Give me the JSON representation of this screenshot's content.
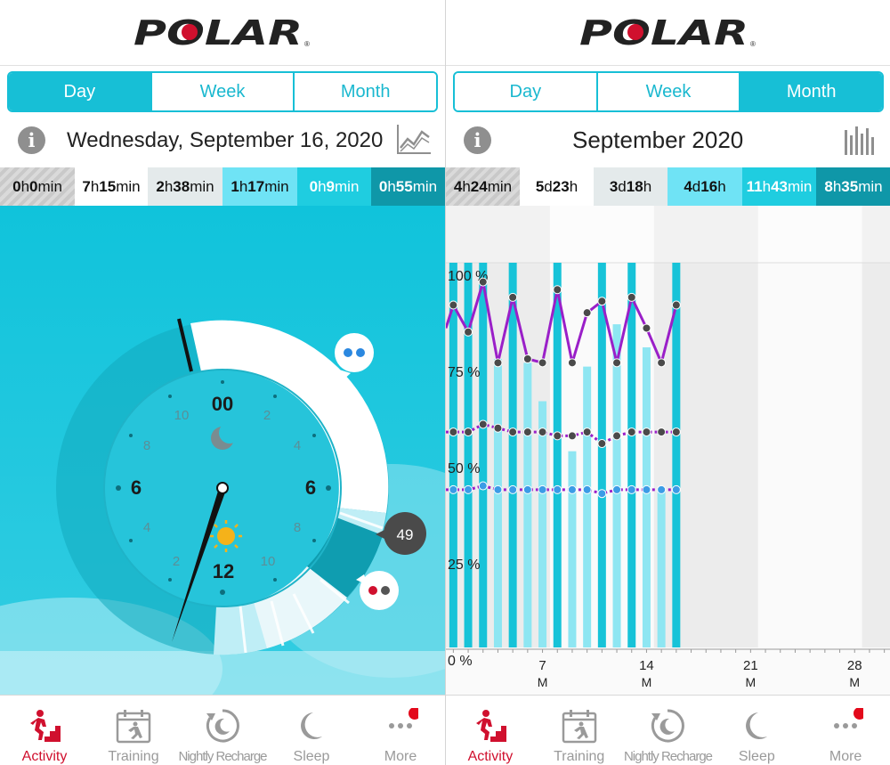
{
  "left": {
    "logo_text": "POLAR",
    "segments": [
      {
        "label": "Day",
        "active": true
      },
      {
        "label": "Week",
        "active": false
      },
      {
        "label": "Month",
        "active": false
      }
    ],
    "date": "Wednesday, September 16, 2020",
    "tiles": [
      {
        "num1": "0",
        "unit1": "h",
        "num2": "0",
        "unit2": "min"
      },
      {
        "num1": "7",
        "unit1": "h",
        "num2": "15",
        "unit2": "min"
      },
      {
        "num1": "2",
        "unit1": "h",
        "num2": "38",
        "unit2": "min"
      },
      {
        "num1": "1",
        "unit1": "h",
        "num2": "17",
        "unit2": "min"
      },
      {
        "num1": "0",
        "unit1": "h",
        "num2": "9",
        "unit2": "min"
      },
      {
        "num1": "0",
        "unit1": "h",
        "num2": "55",
        "unit2": "min"
      }
    ],
    "clock": {
      "labels_major": [
        "00",
        "6",
        "6",
        "12"
      ],
      "labels_minor": [
        "10",
        "2",
        "8",
        "4",
        "4",
        "8",
        "2",
        "10"
      ],
      "bubble_value": "49"
    }
  },
  "right": {
    "logo_text": "POLAR",
    "segments": [
      {
        "label": "Day",
        "active": false
      },
      {
        "label": "Week",
        "active": false
      },
      {
        "label": "Month",
        "active": true
      }
    ],
    "date": "September 2020",
    "tiles": [
      {
        "num1": "4",
        "unit1": "h",
        "num2": "24",
        "unit2": "min"
      },
      {
        "num1": "5",
        "unit1": "d",
        "num2": "23",
        "unit2": "h"
      },
      {
        "num1": "3",
        "unit1": "d",
        "num2": "18",
        "unit2": "h"
      },
      {
        "num1": "4",
        "unit1": "d",
        "num2": "16",
        "unit2": "h"
      },
      {
        "num1": "11",
        "unit1": "h",
        "num2": "43",
        "unit2": "min"
      },
      {
        "num1": "8",
        "unit1": "h",
        "num2": "35",
        "unit2": "min"
      }
    ]
  },
  "chart_data": {
    "type": "bar",
    "title": "",
    "y_ticks": [
      "100 %",
      "75 %",
      "50 %",
      "25 %",
      "0 %"
    ],
    "x_ticks": [
      {
        "day": "7",
        "weekday": "M"
      },
      {
        "day": "14",
        "weekday": "M"
      },
      {
        "day": "21",
        "weekday": "M"
      },
      {
        "day": "28",
        "weekday": "M"
      }
    ],
    "ylim": [
      0,
      100
    ],
    "days": [
      1,
      2,
      3,
      4,
      5,
      6,
      7,
      8,
      9,
      10,
      11,
      12,
      13,
      14,
      15,
      16
    ],
    "series": [
      {
        "values": [
          100,
          100,
          100,
          75,
          100,
          74,
          64,
          100,
          51,
          73,
          100,
          84,
          100,
          78,
          41,
          100
        ]
      },
      {
        "values": [
          89,
          82,
          95,
          74,
          91,
          75,
          74,
          93,
          74,
          87,
          90,
          74,
          91,
          83,
          74,
          89
        ]
      },
      {
        "values": [
          56,
          56,
          58,
          57,
          56,
          56,
          56,
          55,
          55,
          56,
          53,
          55,
          56,
          56,
          56,
          56
        ]
      },
      {
        "values": [
          41,
          41,
          42,
          41,
          41,
          41,
          41,
          41,
          41,
          41,
          40,
          41,
          41,
          41,
          41,
          41
        ]
      }
    ],
    "colors": {
      "bar_full": "#17c3d8",
      "bar_light": "#8ee6f2",
      "line": "#9a1fc8",
      "dot": "#4a4a4a",
      "dot_blue": "#3b9ce6"
    }
  },
  "tabbar": {
    "items": [
      {
        "label": "Activity",
        "icon": "activity-icon",
        "active": true
      },
      {
        "label": "Training",
        "icon": "training-icon",
        "active": false
      },
      {
        "label": "Nightly Recharge",
        "icon": "nightly-recharge-icon",
        "active": false
      },
      {
        "label": "Sleep",
        "icon": "sleep-icon",
        "active": false
      },
      {
        "label": "More",
        "icon": "more-icon",
        "active": false
      }
    ]
  }
}
